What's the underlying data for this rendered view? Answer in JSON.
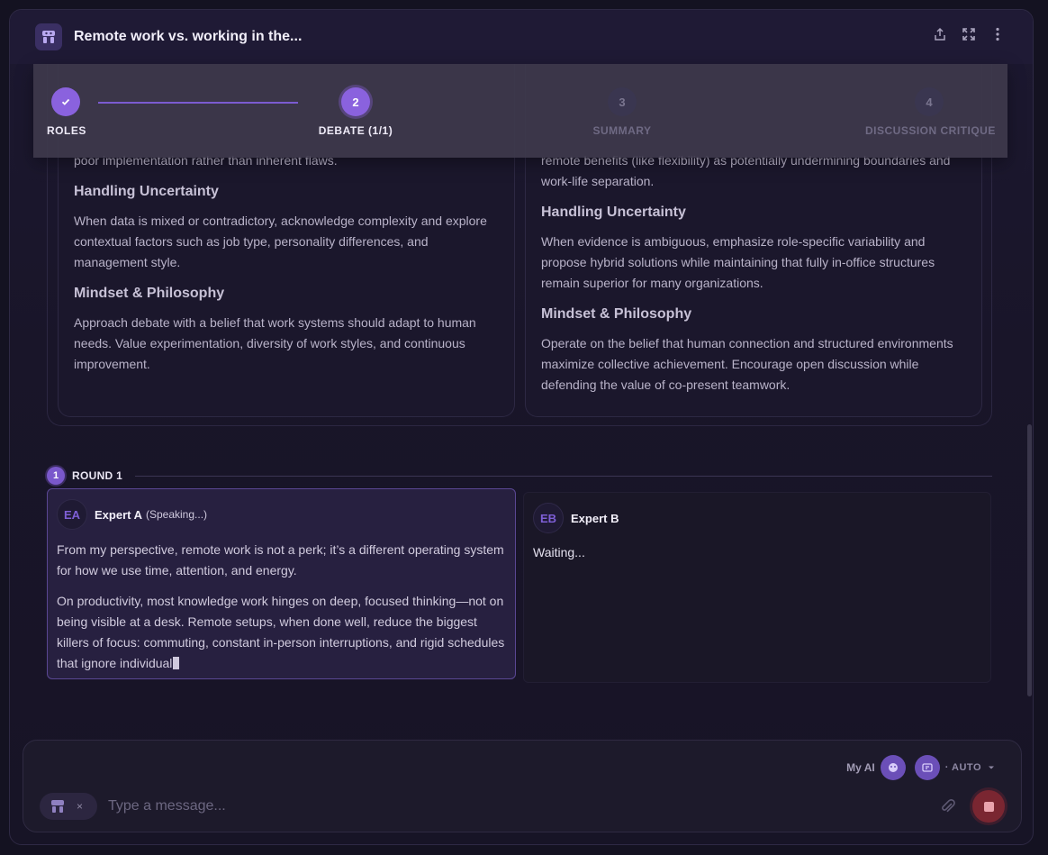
{
  "header": {
    "title": "Remote work vs. working in the..."
  },
  "stepper": {
    "steps": [
      {
        "number": "",
        "label": "ROLES",
        "state": "done"
      },
      {
        "number": "2",
        "label": "DEBATE (1/1)",
        "state": "active"
      },
      {
        "number": "3",
        "label": "SUMMARY",
        "state": "todo"
      },
      {
        "number": "4",
        "label": "DISCUSSION CRITIQUE",
        "state": "todo"
      }
    ]
  },
  "roles": {
    "a": {
      "intro": "poor implementation rather than inherent flaws.",
      "uncertainty_heading": "Handling Uncertainty",
      "uncertainty_text": "When data is mixed or contradictory, acknowledge complexity and explore contextual factors such as job type, personality differences, and management style.",
      "mindset_heading": "Mindset & Philosophy",
      "mindset_text": "Approach debate with a belief that work systems should adapt to human needs. Value experimentation, diversity of work styles, and continuous improvement."
    },
    "b": {
      "intro": "remote benefits (like flexibility) as potentially undermining boundaries and work-life separation.",
      "uncertainty_heading": "Handling Uncertainty",
      "uncertainty_text": "When evidence is ambiguous, emphasize role-specific variability and propose hybrid solutions while maintaining that fully in-office structures remain superior for many organizations.",
      "mindset_heading": "Mindset & Philosophy",
      "mindset_text": "Operate on the belief that human connection and structured environments maximize collective achievement. Encourage open discussion while defending the value of co-present teamwork."
    }
  },
  "round": {
    "number": "1",
    "label": "ROUND 1"
  },
  "experts": {
    "a": {
      "initials": "EA",
      "name": "Expert A",
      "status": "(Speaking...)",
      "para1": "From my perspective, remote work is not a perk; it’s a different operating system for how we use time, attention, and energy.",
      "para2": "On productivity, most knowledge work hinges on deep, focused thinking—not on being visible at a desk. Remote setups, when done well, reduce the biggest killers of focus: commuting, constant in-person interruptions, and rigid schedules that ignore individual"
    },
    "b": {
      "initials": "EB",
      "name": "Expert B",
      "status_text": "Waiting..."
    }
  },
  "composer": {
    "model_label": "My AI",
    "mode_label": "· AUTO",
    "placeholder": "Type a message...",
    "tag_close": "×"
  },
  "colors": {
    "accent": "#8a62de",
    "stop": "#7a2631",
    "background": "#141221"
  },
  "icons": [
    "app-logo-icon",
    "share-icon",
    "fullscreen-icon",
    "more-vertical-icon",
    "check-icon",
    "ai-avatar-icon",
    "model-icon",
    "chevron-down-icon",
    "paperclip-icon",
    "stop-icon"
  ]
}
